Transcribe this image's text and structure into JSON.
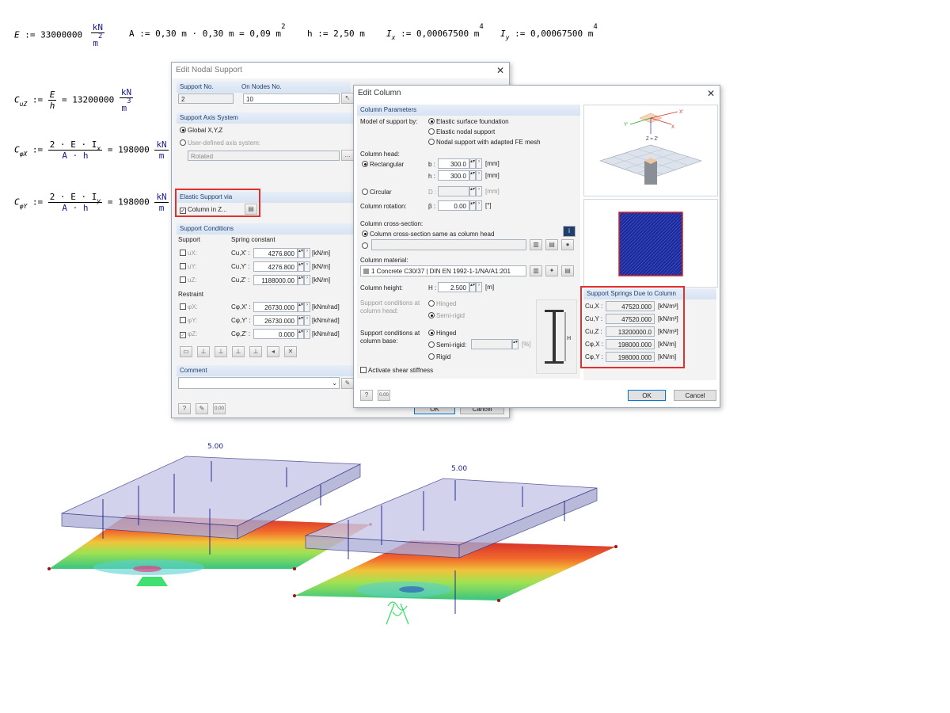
{
  "formulas": {
    "E_lhs": "E",
    "E_rhs": ":= 33000000",
    "E_unit_n": "kN",
    "E_unit_d": "m",
    "E_unit_d_exp": "2",
    "A_expr": "A := 0,30 m · 0,30 m = 0,09 m",
    "A_exp": "2",
    "h_expr": "h := 2,50 m",
    "Ix_lhs": "I",
    "Ix_sub": "x",
    "Ix_rhs": ":= 0,00067500 m",
    "Ix_exp": "4",
    "Iy_lhs": "I",
    "Iy_sub": "y",
    "Iy_rhs": ":= 0,00067500 m",
    "Iy_exp": "4",
    "CuZ_lhs": "C",
    "CuZ_sub": "uZ",
    "CuZ_num": "E",
    "CuZ_den": "h",
    "CuZ_res": "= 13200000",
    "CuZ_unit_n": "kN",
    "CuZ_unit_d": "m",
    "CuZ_unit_exp": "3",
    "CphiX_lhs": "C",
    "CphiX_sub": "φX",
    "CphiX_num": "2 · E · I",
    "CphiX_num_sub": "x",
    "CphiX_den": "A · h",
    "CphiX_res": "= 198000",
    "CphiX_unit_n": "kN",
    "CphiX_unit_d": "m",
    "CphiY_lhs": "C",
    "CphiY_sub": "φY",
    "CphiY_num": "2 · E · I",
    "CphiY_num_sub": "y",
    "CphiY_den": "A · h",
    "CphiY_res": "= 198000",
    "CphiY_unit_n": "kN",
    "CphiY_unit_d": "m"
  },
  "nodal_dialog": {
    "title": "Edit Nodal Support",
    "support_no_label": "Support No.",
    "support_no": "2",
    "on_nodes_label": "On Nodes No.",
    "on_nodes": "10",
    "axis_system_head": "Support Axis System",
    "global_label": "Global X,Y,Z",
    "user_defined_label": "User-defined axis system:",
    "rotated_value": "Rotated",
    "elastic_head": "Elastic Support via",
    "column_in_z": "Column in Z...",
    "conditions_head": "Support Conditions",
    "support_col": "Support",
    "spring_col": "Spring constant",
    "rows": [
      {
        "label": "uX:",
        "sym": "Cu,X' :",
        "value": "4276.800",
        "unit": "[kN/m]"
      },
      {
        "label": "uY:",
        "sym": "Cu,Y' :",
        "value": "4276.800",
        "unit": "[kN/m]"
      },
      {
        "label": "uZ:",
        "sym": "Cu,Z' :",
        "value": "1188000.00",
        "unit": "[kN/m]"
      }
    ],
    "restraint_label": "Restraint",
    "rrows": [
      {
        "label": "φX:",
        "sym": "Cφ,X' :",
        "value": "26730.000",
        "unit": "[kNm/rad]"
      },
      {
        "label": "φY:",
        "sym": "Cφ,Y' :",
        "value": "26730.000",
        "unit": "[kNm/rad]"
      },
      {
        "label": "φZ:",
        "sym": "Cφ,Z' :",
        "value": "0.000",
        "unit": "[kNm/rad]"
      }
    ],
    "comment_head": "Comment",
    "ok": "OK",
    "cancel": "Cancel"
  },
  "column_dialog": {
    "title": "Edit Column",
    "params_head": "Column Parameters",
    "model_label": "Model of support by:",
    "model_opts": [
      "Elastic surface foundation",
      "Elastic nodal support",
      "Nodal support with adapted FE mesh"
    ],
    "head_label": "Column head:",
    "rect_label": "Rectangular",
    "b_label": "b :",
    "b_value": "300.0",
    "h_label": "h :",
    "h_value": "300.0",
    "mm": "[mm]",
    "circular_label": "Circular",
    "d_label": "D :",
    "mm2": "[mm]",
    "rotation_label": "Column rotation:",
    "beta_label": "β :",
    "beta_value": "0.00",
    "deg": "[°]",
    "cross_label": "Column cross-section:",
    "cross_same": "Column cross-section same as column head",
    "material_label": "Column material:",
    "material_value": "1  Concrete C30/37 | DIN EN 1992-1-1/NA/A1:201",
    "height_label": "Column height:",
    "H_label": "H :",
    "H_value": "2.500",
    "m": "[m]",
    "head_cond_label": "Support conditions at column head:",
    "hinged": "Hinged",
    "semirigid": "Semi-rigid",
    "base_cond_label": "Support conditions at column base:",
    "base_hinged": "Hinged",
    "base_semirigid": "Semi-rigid:",
    "base_rigid": "Rigid",
    "pct": "[%]",
    "shear_label": "Activate shear stiffness",
    "springs_head": "Support Springs Due to Column",
    "springs": [
      {
        "sym": "Cu,X :",
        "value": "47520.000",
        "unit": "[kN/m³]"
      },
      {
        "sym": "Cu,Y :",
        "value": "47520.000",
        "unit": "[kN/m³]"
      },
      {
        "sym": "Cu,Z :",
        "value": "13200000.0",
        "unit": "[kN/m³]"
      },
      {
        "sym": "Cφ,X :",
        "value": "198000.000",
        "unit": "[kN/m]"
      },
      {
        "sym": "Cφ,Y :",
        "value": "198000.000",
        "unit": "[kN/m]"
      }
    ],
    "ok": "OK",
    "cancel": "Cancel"
  },
  "render": {
    "left_load": "5.00",
    "right_load": "5.00"
  },
  "colors": {
    "highlight": "#e03030",
    "accent": "#1f3f6e"
  }
}
